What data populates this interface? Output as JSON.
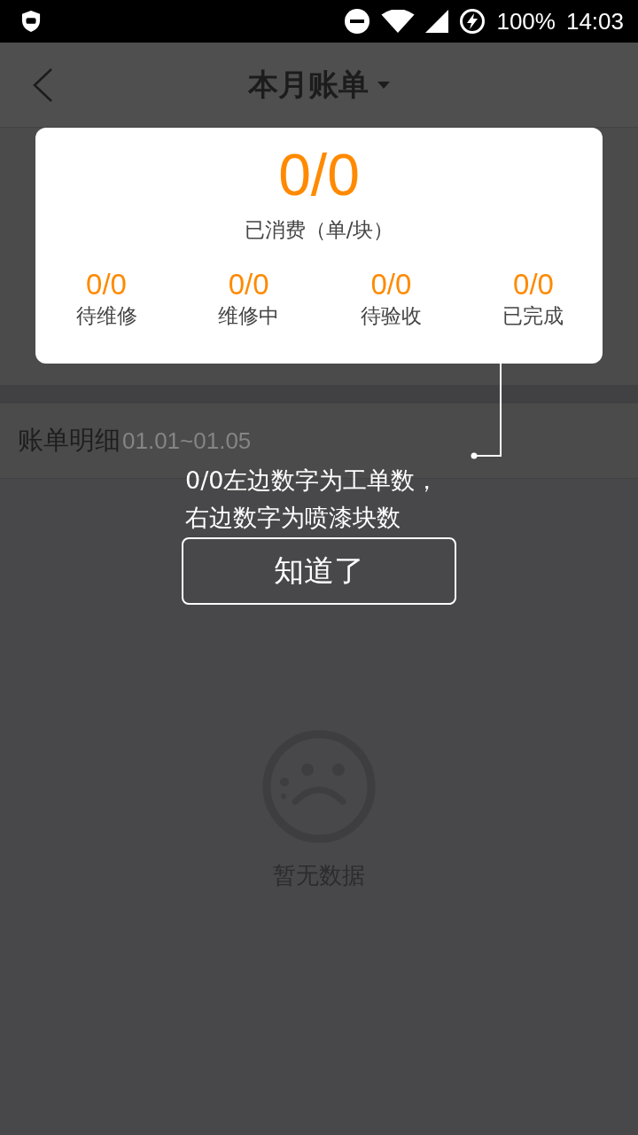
{
  "status_bar": {
    "battery": "100%",
    "time": "14:03"
  },
  "header": {
    "title": "本月账单"
  },
  "bill_detail": {
    "label": "账单明细",
    "date_range": "01.01~01.05"
  },
  "empty_state": {
    "message": "暂无数据"
  },
  "guide": {
    "summary": {
      "value": "0/0",
      "label": "已消费（单/块）"
    },
    "stats": [
      {
        "value": "0/0",
        "label": "待维修"
      },
      {
        "value": "0/0",
        "label": "维修中"
      },
      {
        "value": "0/0",
        "label": "待验收"
      },
      {
        "value": "0/0",
        "label": "已完成"
      }
    ],
    "tip": [
      "0/0左边数字为工单数，",
      "右边数字为喷漆块数"
    ],
    "button": "知道了"
  }
}
